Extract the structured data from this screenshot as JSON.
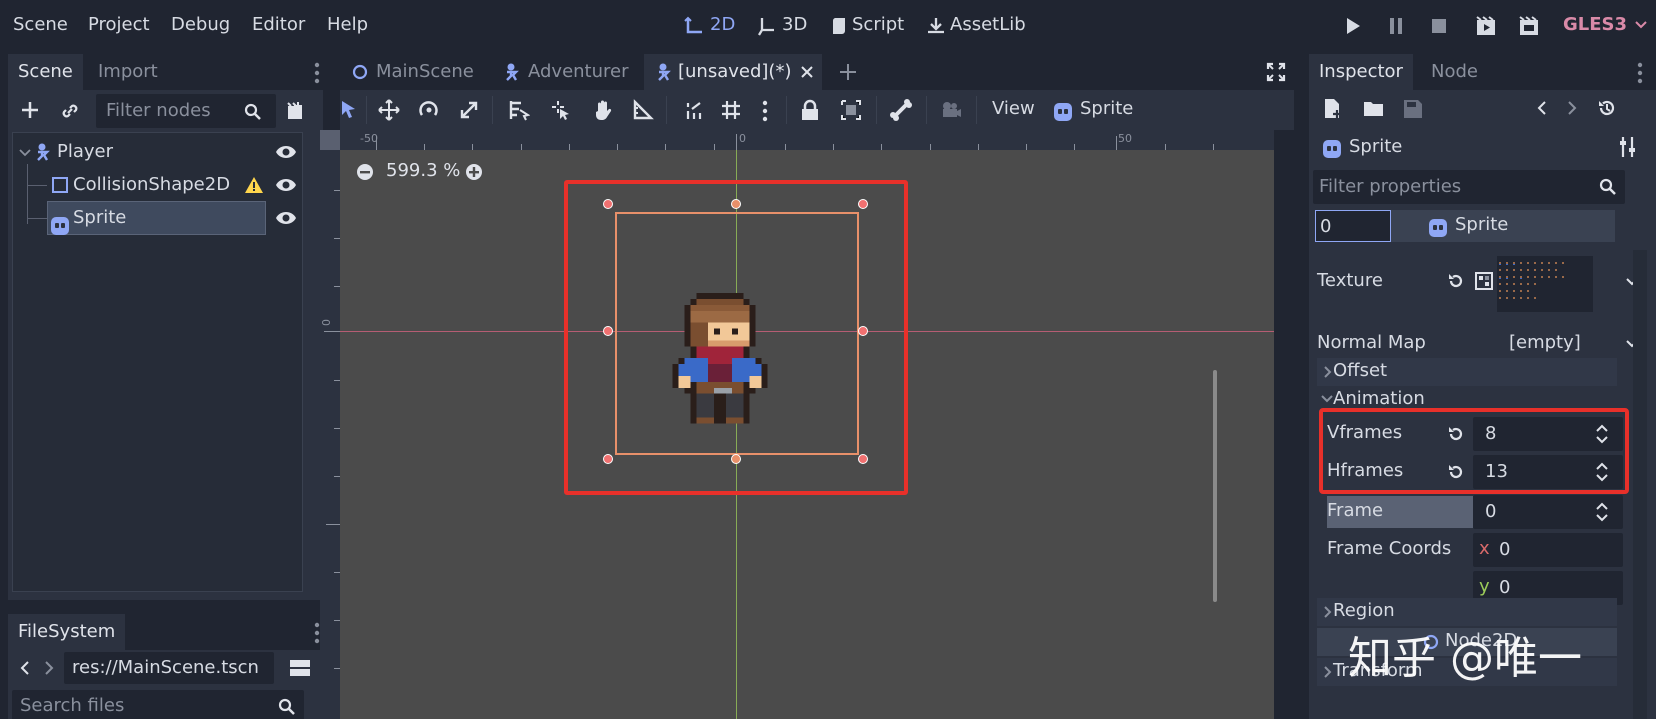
{
  "menu": {
    "items": [
      "Scene",
      "Project",
      "Debug",
      "Editor",
      "Help"
    ],
    "modes": [
      "2D",
      "3D",
      "Script",
      "AssetLib"
    ],
    "renderer": "GLES3"
  },
  "scene_dock": {
    "tabs": [
      "Scene",
      "Import"
    ],
    "filter_placeholder": "Filter nodes",
    "nodes": [
      {
        "label": "Player",
        "icon": "kinematic-body-icon"
      },
      {
        "label": "CollisionShape2D",
        "icon": "collision-shape-icon",
        "warning": true
      },
      {
        "label": "Sprite",
        "icon": "sprite-icon",
        "selected": true
      }
    ]
  },
  "filesystem_dock": {
    "tab": "FileSystem",
    "path": "res://MainScene.tscn",
    "search_placeholder": "Search files"
  },
  "editor_tabs": [
    {
      "label": "MainScene",
      "icon": "node2d-icon"
    },
    {
      "label": "Adventurer",
      "icon": "kinematic-body-icon"
    },
    {
      "label": "[unsaved](*)",
      "icon": "kinematic-body-icon",
      "active": true
    }
  ],
  "toolbar": {
    "view_label": "View",
    "sprite_label": "Sprite"
  },
  "viewport": {
    "zoom": "599.3 %",
    "ruler_labels": [
      "-50",
      "0",
      "50"
    ],
    "ruler_v_label": "0",
    "colors": {
      "selection_box": "#e8302a",
      "sprite_rect": "#e8906a",
      "handle": "#f07070",
      "x_axis": "#c8607a",
      "y_axis": "#9ccc5a"
    }
  },
  "inspector": {
    "tabs": [
      "Inspector",
      "Node"
    ],
    "object_name": "Sprite",
    "filter_placeholder": "Filter properties",
    "section_field_value": "0",
    "section_title": "Sprite",
    "texture_label": "Texture",
    "normal_map_label": "Normal Map",
    "normal_map_value": "[empty]",
    "offset_label": "Offset",
    "animation_label": "Animation",
    "vframes_label": "Vframes",
    "vframes_value": "8",
    "hframes_label": "Hframes",
    "hframes_value": "13",
    "frame_label": "Frame",
    "frame_value": "0",
    "frame_coords_label": "Frame Coords",
    "frame_coords_x_label": "x",
    "frame_coords_x": "0",
    "frame_coords_y_label": "y",
    "frame_coords_y": "0",
    "region_label": "Region",
    "node2d_label": "Node2D",
    "transform_label": "Transform"
  },
  "watermark": "知乎 @唯一"
}
